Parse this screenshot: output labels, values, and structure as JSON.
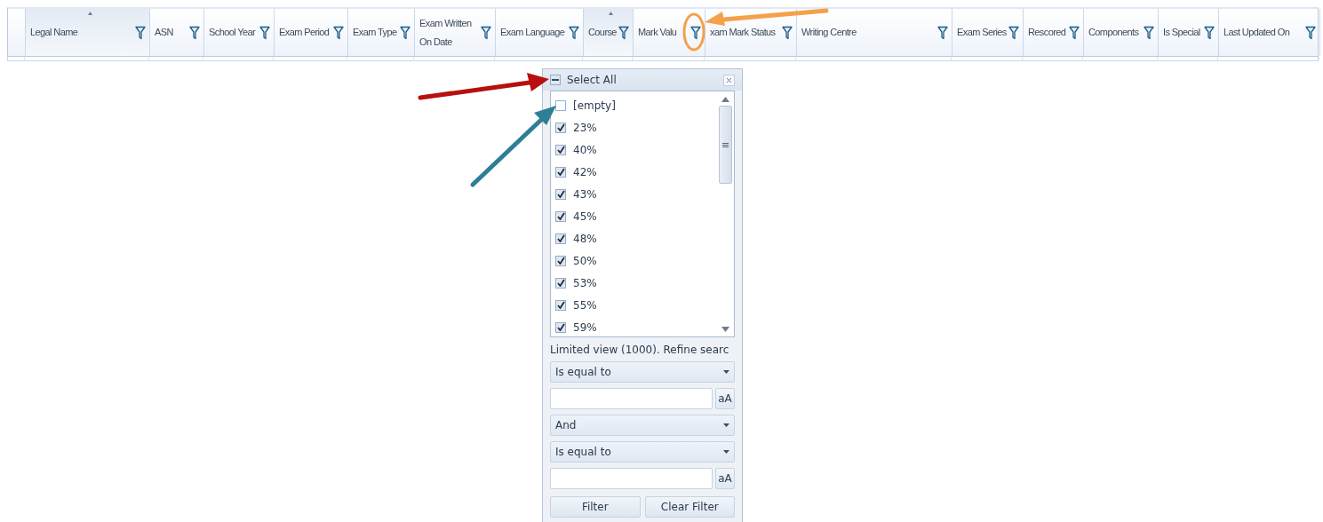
{
  "grid": {
    "columns": [
      {
        "label": "Legal Name",
        "sorted": true
      },
      {
        "label": "ASN",
        "sorted": false
      },
      {
        "label": "School Year",
        "sorted": false
      },
      {
        "label": "Exam Period",
        "sorted": false
      },
      {
        "label": "Exam Type",
        "sorted": false
      },
      {
        "label": "Exam Written On Date",
        "sorted": false
      },
      {
        "label": "Exam Language",
        "sorted": false
      },
      {
        "label": "Course",
        "sorted": true
      },
      {
        "label": "Mark Valu",
        "sorted": false
      },
      {
        "label": "xam Mark Status",
        "sorted": false
      },
      {
        "label": "Writing Centre",
        "sorted": false
      },
      {
        "label": "Exam Series",
        "sorted": false
      },
      {
        "label": "Rescored",
        "sorted": false
      },
      {
        "label": "Components",
        "sorted": false
      },
      {
        "label": "Is Special",
        "sorted": false
      },
      {
        "label": "Last Updated On",
        "sorted": false
      }
    ]
  },
  "filter_popup": {
    "select_all": {
      "label": "Select All",
      "indeterminate": true
    },
    "items": [
      {
        "label": "[empty]",
        "checked": false
      },
      {
        "label": "23%",
        "checked": true
      },
      {
        "label": "40%",
        "checked": true
      },
      {
        "label": "42%",
        "checked": true
      },
      {
        "label": "43%",
        "checked": true
      },
      {
        "label": "45%",
        "checked": true
      },
      {
        "label": "48%",
        "checked": true
      },
      {
        "label": "50%",
        "checked": true
      },
      {
        "label": "53%",
        "checked": true
      },
      {
        "label": "55%",
        "checked": true
      },
      {
        "label": "59%",
        "checked": true
      }
    ],
    "notice": "Limited view (1000). Refine searc",
    "rows": [
      {
        "kind": "dropdown",
        "value": "Is equal to"
      },
      {
        "kind": "input",
        "case_button": "aA"
      },
      {
        "kind": "dropdown",
        "value": "And"
      },
      {
        "kind": "dropdown",
        "value": "Is equal to"
      },
      {
        "kind": "input",
        "case_button": "aA"
      }
    ],
    "buttons": [
      "Filter",
      "Clear Filter"
    ]
  }
}
